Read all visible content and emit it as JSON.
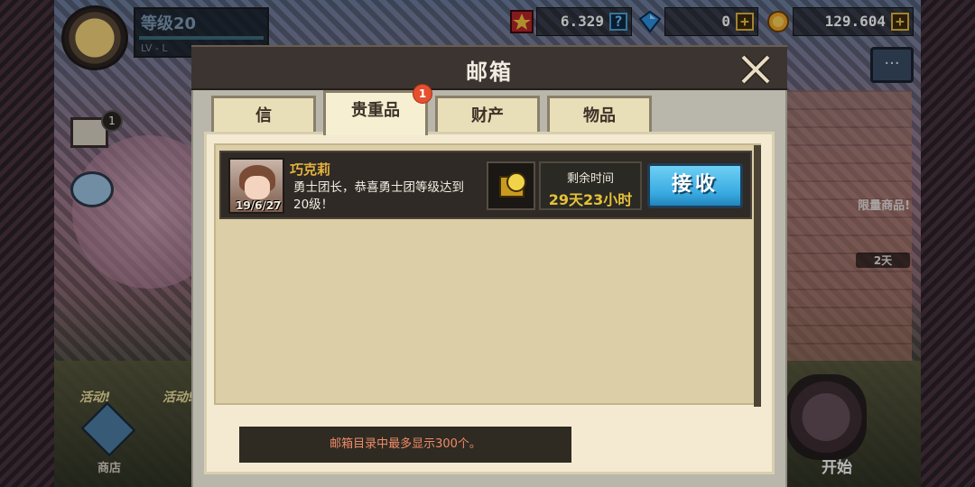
{
  "hud": {
    "level_title": "等级20",
    "level_sub": "LV - L",
    "medal_count": "6.329",
    "gems": "0",
    "gold": "129.604",
    "plus_symbol": "+",
    "help_symbol": "?"
  },
  "side": {
    "mail_badge": "1",
    "limited_label": "限量商品!",
    "days_label": "2天",
    "shop_label": "商店",
    "start_label": "开始",
    "event_tag": "活动!",
    "event_tag2": "活动!"
  },
  "mailbox": {
    "title": "邮箱",
    "tabs": [
      {
        "label": "信",
        "active": false
      },
      {
        "label": "贵重品",
        "active": true,
        "badge": "1"
      },
      {
        "label": "财产",
        "active": false
      },
      {
        "label": "物品",
        "active": false
      }
    ],
    "mails": [
      {
        "sender": "巧克莉",
        "date": "19/6/27",
        "message": "勇士团长，恭喜勇士团等级达到20级！",
        "time_label": "剩余时间",
        "time_value": "29天23小时",
        "button_label": "接收"
      }
    ],
    "footer_note": "邮箱目录中最多显示300个。"
  }
}
